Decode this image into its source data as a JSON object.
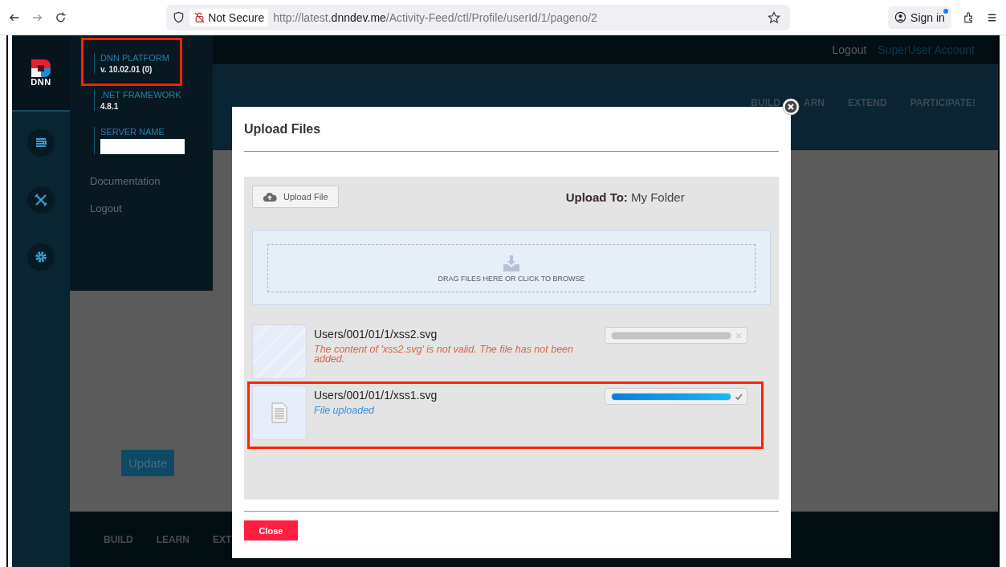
{
  "browser": {
    "security": "Not Secure",
    "url": "http://latest.**dnndev.me**/Activity-Feed/ctl/Profile/userId/1/pageno/2",
    "sign_in": "Sign in"
  },
  "persona_bar": {
    "logo_text": "DNN",
    "info": [
      {
        "kind": "text",
        "label": "DNN PLATFORM",
        "value": "v. 10.02.01 (0)",
        "highlighted": true
      },
      {
        "kind": "text",
        "label": ".NET FRAMEWORK",
        "value": "4.8.1",
        "highlighted": false
      },
      {
        "kind": "redacted",
        "label": "SERVER NAME",
        "highlighted": false
      }
    ],
    "links": [
      "Documentation",
      "Logout"
    ]
  },
  "top_bar": {
    "links": [
      "Logout",
      "SuperUser Account"
    ]
  },
  "header_nav": [
    "BUILD",
    "ARN",
    "EXTEND",
    "PARTICIPATE!"
  ],
  "content": {
    "button": "Update"
  },
  "footer_nav": [
    "BUILD",
    "LEARN",
    "EXT"
  ],
  "dialog": {
    "title": "Upload Files",
    "upload_button": "Upload File",
    "upload_to_label": "Upload To:",
    "upload_to_value": "My Folder",
    "dropzone": "DRAG FILES HERE OR CLICK TO BROWSE",
    "files": [
      {
        "name": "Users/001/01/1/xss2.svg",
        "message": "The content of 'xss2.svg' is not valid. The file has not been added.",
        "kind": "error",
        "level": 1,
        "highlighted": false
      },
      {
        "name": "Users/001/01/1/xss1.svg",
        "message": "File uploaded",
        "kind": "done",
        "level": 1,
        "highlighted": true
      }
    ],
    "close_button": "Close"
  }
}
